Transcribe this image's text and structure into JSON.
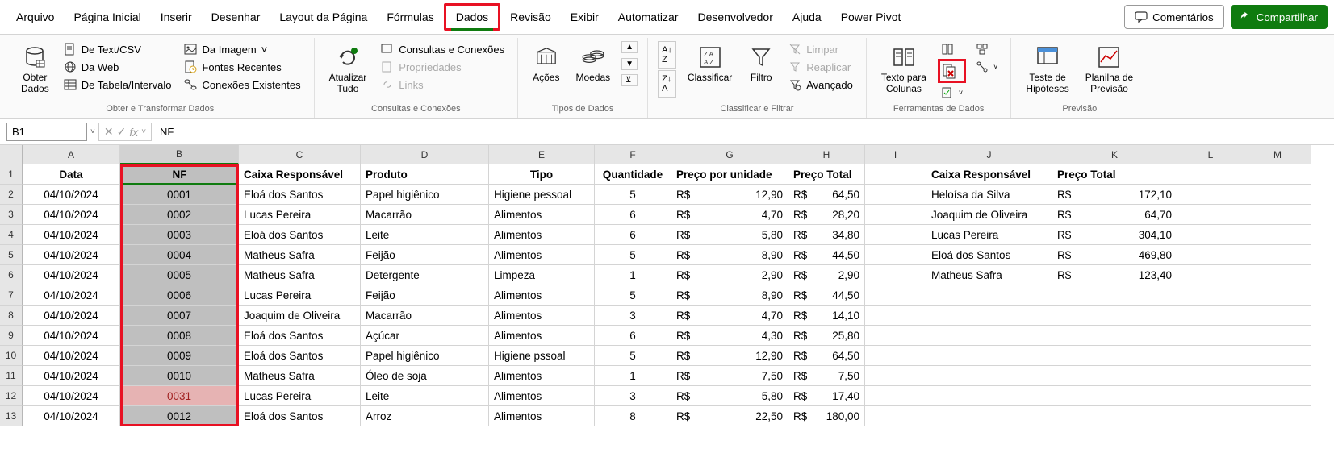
{
  "menubar": {
    "items": [
      "Arquivo",
      "Página Inicial",
      "Inserir",
      "Desenhar",
      "Layout da Página",
      "Fórmulas",
      "Dados",
      "Revisão",
      "Exibir",
      "Automatizar",
      "Desenvolvedor",
      "Ajuda",
      "Power Pivot"
    ],
    "active_index": 6,
    "comments": "Comentários",
    "share": "Compartilhar"
  },
  "ribbon": {
    "group1": {
      "label": "Obter e Transformar Dados",
      "obter_dados": "Obter\nDados",
      "text_csv": "De Text/CSV",
      "da_web": "Da Web",
      "tabela": "De Tabela/Intervalo",
      "da_imagem": "Da Imagem",
      "fontes_recentes": "Fontes Recentes",
      "conexoes": "Conexões Existentes"
    },
    "group2": {
      "label": "Consultas e Conexões",
      "atualizar": "Atualizar\nTudo",
      "consultas": "Consultas e Conexões",
      "propriedades": "Propriedades",
      "links": "Links"
    },
    "group3": {
      "label": "Tipos de Dados",
      "acoes": "Ações",
      "moedas": "Moedas"
    },
    "group4": {
      "label": "Classificar e Filtrar",
      "classificar": "Classificar",
      "filtro": "Filtro",
      "limpar": "Limpar",
      "reaplicar": "Reaplicar",
      "avancado": "Avançado"
    },
    "group5": {
      "label": "Ferramentas de Dados",
      "texto_colunas": "Texto para\nColunas"
    },
    "group6": {
      "label": "Previsão",
      "teste": "Teste de\nHipóteses",
      "planilha": "Planilha de\nPrevisão"
    }
  },
  "formula_bar": {
    "name_box": "B1",
    "formula": "NF"
  },
  "grid": {
    "columns": [
      "A",
      "B",
      "C",
      "D",
      "E",
      "F",
      "G",
      "H",
      "I",
      "J",
      "K",
      "L",
      "M"
    ],
    "selected_col_index": 1,
    "row_numbers": [
      1,
      2,
      3,
      4,
      5,
      6,
      7,
      8,
      9,
      10,
      11,
      12,
      13
    ],
    "headers": {
      "A": "Data",
      "B": "NF",
      "C": "Caixa Responsável",
      "D": "Produto",
      "E": "Tipo",
      "F": "Quantidade",
      "G": "Preço por unidade",
      "H": "Preço Total",
      "J": "Caixa Responsável",
      "K": "Preço Total"
    },
    "rows": [
      {
        "A": "04/10/2024",
        "B": "0001",
        "C": "Eloá dos Santos",
        "D": "Papel higiênico",
        "E": "Higiene pessoal",
        "F": "5",
        "G_cur": "R$",
        "G_val": "12,90",
        "H_cur": "R$",
        "H_val": "64,50",
        "J": "Heloísa da Silva",
        "K_cur": "R$",
        "K_val": "172,10"
      },
      {
        "A": "04/10/2024",
        "B": "0002",
        "C": "Lucas Pereira",
        "D": "Macarrão",
        "E": "Alimentos",
        "F": "6",
        "G_cur": "R$",
        "G_val": "4,70",
        "H_cur": "R$",
        "H_val": "28,20",
        "J": "Joaquim de Oliveira",
        "K_cur": "R$",
        "K_val": "64,70"
      },
      {
        "A": "04/10/2024",
        "B": "0003",
        "C": "Eloá dos Santos",
        "D": "Leite",
        "E": "Alimentos",
        "F": "6",
        "G_cur": "R$",
        "G_val": "5,80",
        "H_cur": "R$",
        "H_val": "34,80",
        "J": "Lucas Pereira",
        "K_cur": "R$",
        "K_val": "304,10"
      },
      {
        "A": "04/10/2024",
        "B": "0004",
        "C": "Matheus Safra",
        "D": "Feijão",
        "E": "Alimentos",
        "F": "5",
        "G_cur": "R$",
        "G_val": "8,90",
        "H_cur": "R$",
        "H_val": "44,50",
        "J": "Eloá dos Santos",
        "K_cur": "R$",
        "K_val": "469,80"
      },
      {
        "A": "04/10/2024",
        "B": "0005",
        "C": "Matheus Safra",
        "D": "Detergente",
        "E": "Limpeza",
        "F": "1",
        "G_cur": "R$",
        "G_val": "2,90",
        "H_cur": "R$",
        "H_val": "2,90",
        "J": "Matheus Safra",
        "K_cur": "R$",
        "K_val": "123,40"
      },
      {
        "A": "04/10/2024",
        "B": "0006",
        "C": "Lucas Pereira",
        "D": "Feijão",
        "E": "Alimentos",
        "F": "5",
        "G_cur": "R$",
        "G_val": "8,90",
        "H_cur": "R$",
        "H_val": "44,50"
      },
      {
        "A": "04/10/2024",
        "B": "0007",
        "C": "Joaquim de Oliveira",
        "D": "Macarrão",
        "E": "Alimentos",
        "F": "3",
        "G_cur": "R$",
        "G_val": "4,70",
        "H_cur": "R$",
        "H_val": "14,10"
      },
      {
        "A": "04/10/2024",
        "B": "0008",
        "C": "Eloá dos Santos",
        "D": "Açúcar",
        "E": "Alimentos",
        "F": "6",
        "G_cur": "R$",
        "G_val": "4,30",
        "H_cur": "R$",
        "H_val": "25,80"
      },
      {
        "A": "04/10/2024",
        "B": "0009",
        "C": "Eloá dos Santos",
        "D": "Papel higiênico",
        "E": "Higiene pssoal",
        "F": "5",
        "G_cur": "R$",
        "G_val": "12,90",
        "H_cur": "R$",
        "H_val": "64,50"
      },
      {
        "A": "04/10/2024",
        "B": "0010",
        "C": "Matheus Safra",
        "D": "Óleo de soja",
        "E": "Alimentos",
        "F": "1",
        "G_cur": "R$",
        "G_val": "7,50",
        "H_cur": "R$",
        "H_val": "7,50"
      },
      {
        "A": "04/10/2024",
        "B": "0031",
        "C": "Lucas Pereira",
        "D": "Leite",
        "E": "Alimentos",
        "F": "3",
        "G_cur": "R$",
        "G_val": "5,80",
        "H_cur": "R$",
        "H_val": "17,40",
        "bad": true
      },
      {
        "A": "04/10/2024",
        "B": "0012",
        "C": "Eloá dos Santos",
        "D": "Arroz",
        "E": "Alimentos",
        "F": "8",
        "G_cur": "R$",
        "G_val": "22,50",
        "H_cur": "R$",
        "H_val": "180,00"
      }
    ]
  }
}
